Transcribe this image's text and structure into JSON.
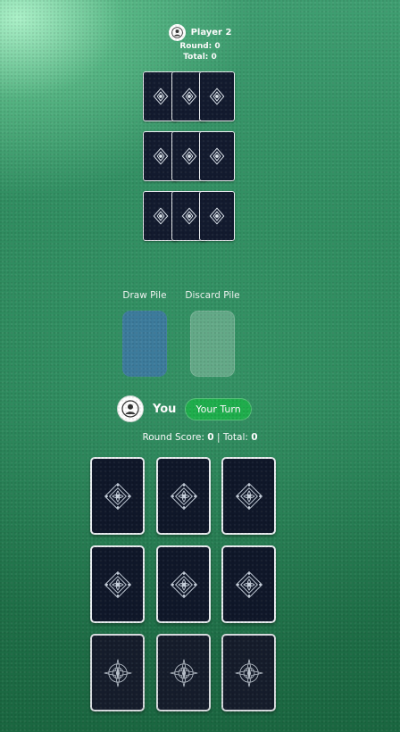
{
  "opponent": {
    "name": "Player 2",
    "round_label": "Round: 0",
    "total_label": "Total: 0",
    "avatar_icon": "user-icon",
    "card_rows": 3,
    "cards_per_row": 3
  },
  "piles": {
    "draw_label": "Draw Pile",
    "discard_label": "Discard Pile",
    "draw_color": "#3d7aa0"
  },
  "player": {
    "name": "You",
    "turn_badge": "Your Turn",
    "round_score_label": "Round Score:",
    "round_score": "0",
    "separator": "|",
    "total_label": "Total:",
    "total": "0",
    "avatar_icon": "user-icon",
    "badge_color": "#1eae4c"
  },
  "card_back": {
    "color": "#0f1729",
    "pattern_icon": "ornament-icon"
  }
}
